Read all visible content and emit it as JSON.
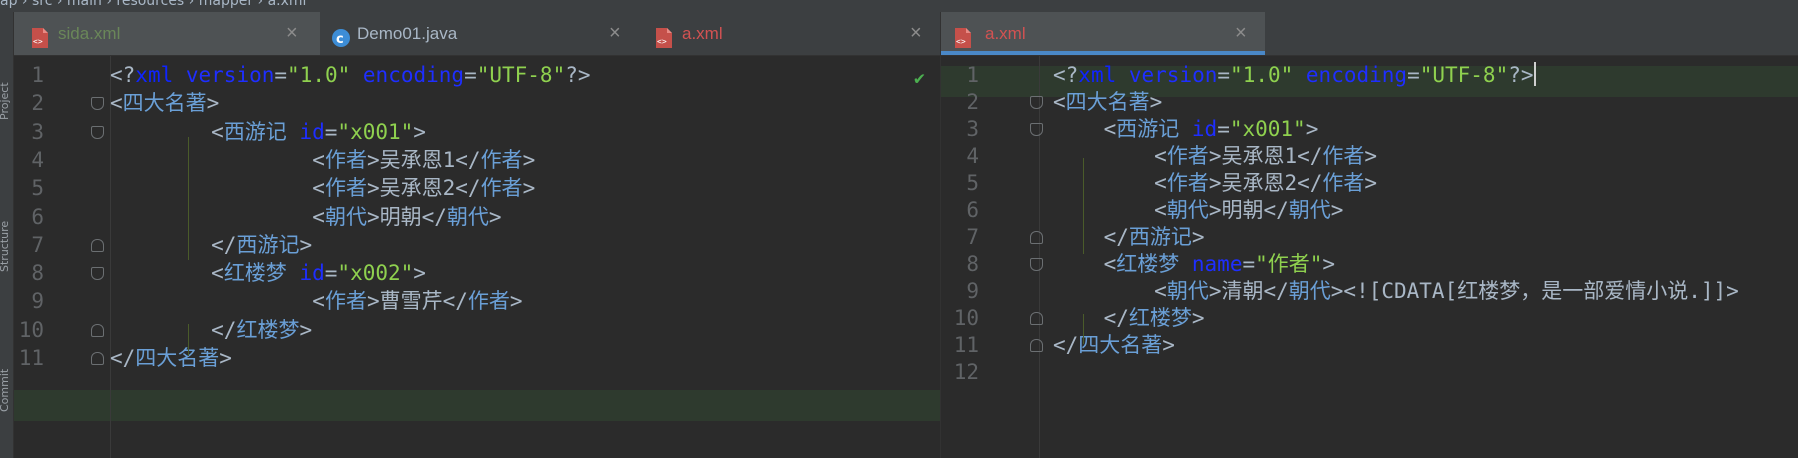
{
  "breadcrumb": "ap ›  src  ›  main  ›  resources  ›  mapper  ›  a.xml",
  "sidebar": {
    "labels": [
      "Project",
      "Structure",
      "Commit"
    ]
  },
  "left_editor": {
    "tabs": [
      {
        "name": "sida.xml",
        "type": "xml",
        "close": "×",
        "color": "#6a8759"
      },
      {
        "name": "Demo01.java",
        "type": "java",
        "close": "×",
        "color": "#a9b7c6"
      },
      {
        "name": "a.xml",
        "type": "xml",
        "close": "×",
        "color": "#d25252"
      }
    ],
    "line_numbers": [
      "1",
      "2",
      "3",
      "4",
      "5",
      "6",
      "7",
      "8",
      "9",
      "10",
      "11"
    ],
    "check_mark": "✔",
    "lines": [
      {
        "indent": "",
        "parts": [
          [
            "tag",
            "<?"
          ],
          [
            "xmldecl",
            "xml "
          ],
          [
            "attr",
            "version"
          ],
          [
            "tag",
            "="
          ],
          [
            "attrv",
            "\"1.0\" "
          ],
          [
            "attr",
            "encoding"
          ],
          [
            "tag",
            "="
          ],
          [
            "attrv",
            "\"UTF-8\""
          ],
          [
            "tag",
            "?>"
          ]
        ]
      },
      {
        "indent": "",
        "parts": [
          [
            "tag",
            "<"
          ],
          [
            "tagname",
            "四大名著"
          ],
          [
            "tag",
            ">"
          ]
        ]
      },
      {
        "indent": "    ",
        "parts": [
          [
            "tag",
            "<"
          ],
          [
            "tagname",
            "西游记 "
          ],
          [
            "attr",
            "id"
          ],
          [
            "tag",
            "="
          ],
          [
            "attrv",
            "\"x001\""
          ],
          [
            "tag",
            ">"
          ]
        ]
      },
      {
        "indent": "        ",
        "parts": [
          [
            "tag",
            "<"
          ],
          [
            "tagname",
            "作者"
          ],
          [
            "tag",
            ">"
          ],
          [
            "txt",
            "吴承恩1"
          ],
          [
            "tag",
            "</"
          ],
          [
            "tagname",
            "作者"
          ],
          [
            "tag",
            ">"
          ]
        ]
      },
      {
        "indent": "        ",
        "parts": [
          [
            "tag",
            "<"
          ],
          [
            "tagname",
            "作者"
          ],
          [
            "tag",
            ">"
          ],
          [
            "txt",
            "吴承恩2"
          ],
          [
            "tag",
            "</"
          ],
          [
            "tagname",
            "作者"
          ],
          [
            "tag",
            ">"
          ]
        ]
      },
      {
        "indent": "        ",
        "parts": [
          [
            "tag",
            "<"
          ],
          [
            "tagname",
            "朝代"
          ],
          [
            "tag",
            ">"
          ],
          [
            "txt",
            "明朝"
          ],
          [
            "tag",
            "</"
          ],
          [
            "tagname",
            "朝代"
          ],
          [
            "tag",
            ">"
          ]
        ]
      },
      {
        "indent": "    ",
        "parts": [
          [
            "tag",
            "</"
          ],
          [
            "tagname",
            "西游记"
          ],
          [
            "tag",
            ">"
          ]
        ]
      },
      {
        "indent": "    ",
        "parts": [
          [
            "tag",
            "<"
          ],
          [
            "tagname",
            "红楼梦 "
          ],
          [
            "attr",
            "id"
          ],
          [
            "tag",
            "="
          ],
          [
            "attrv",
            "\"x002\""
          ],
          [
            "tag",
            ">"
          ]
        ]
      },
      {
        "indent": "        ",
        "parts": [
          [
            "tag",
            "<"
          ],
          [
            "tagname",
            "作者"
          ],
          [
            "tag",
            ">"
          ],
          [
            "txt",
            "曹雪芹"
          ],
          [
            "tag",
            "</"
          ],
          [
            "tagname",
            "作者"
          ],
          [
            "tag",
            ">"
          ]
        ]
      },
      {
        "indent": "    ",
        "parts": [
          [
            "tag",
            "</"
          ],
          [
            "tagname",
            "红楼梦"
          ],
          [
            "tag",
            ">"
          ]
        ]
      },
      {
        "indent": "",
        "parts": [
          [
            "tag",
            "</"
          ],
          [
            "tagname",
            "四大名著"
          ],
          [
            "tag",
            ">"
          ]
        ]
      }
    ]
  },
  "right_editor": {
    "tabs": [
      {
        "name": "a.xml",
        "type": "xml",
        "close": "×",
        "color": "#d25252"
      }
    ],
    "line_numbers": [
      "1",
      "2",
      "3",
      "4",
      "5",
      "6",
      "7",
      "8",
      "9",
      "10",
      "11",
      "12"
    ],
    "lines": [
      {
        "indent": "",
        "parts": [
          [
            "tag",
            "<?"
          ],
          [
            "xmldecl",
            "xml "
          ],
          [
            "attr",
            "version"
          ],
          [
            "tag",
            "="
          ],
          [
            "attrv",
            "\"1.0\" "
          ],
          [
            "attr",
            "encoding"
          ],
          [
            "tag",
            "="
          ],
          [
            "attrv",
            "\"UTF-8\""
          ],
          [
            "tag",
            "?>"
          ]
        ]
      },
      {
        "indent": "",
        "parts": [
          [
            "tag",
            "<"
          ],
          [
            "tagname",
            "四大名著"
          ],
          [
            "tag",
            ">"
          ]
        ]
      },
      {
        "indent": "  ",
        "parts": [
          [
            "tag",
            "<"
          ],
          [
            "tagname",
            "西游记 "
          ],
          [
            "attr",
            "id"
          ],
          [
            "tag",
            "="
          ],
          [
            "attrv",
            "\"x001\""
          ],
          [
            "tag",
            ">"
          ]
        ]
      },
      {
        "indent": "    ",
        "parts": [
          [
            "tag",
            "<"
          ],
          [
            "tagname",
            "作者"
          ],
          [
            "tag",
            ">"
          ],
          [
            "txt",
            "吴承恩1"
          ],
          [
            "tag",
            "</"
          ],
          [
            "tagname",
            "作者"
          ],
          [
            "tag",
            ">"
          ]
        ]
      },
      {
        "indent": "    ",
        "parts": [
          [
            "tag",
            "<"
          ],
          [
            "tagname",
            "作者"
          ],
          [
            "tag",
            ">"
          ],
          [
            "txt",
            "吴承恩2"
          ],
          [
            "tag",
            "</"
          ],
          [
            "tagname",
            "作者"
          ],
          [
            "tag",
            ">"
          ]
        ]
      },
      {
        "indent": "    ",
        "parts": [
          [
            "tag",
            "<"
          ],
          [
            "tagname",
            "朝代"
          ],
          [
            "tag",
            ">"
          ],
          [
            "txt",
            "明朝"
          ],
          [
            "tag",
            "</"
          ],
          [
            "tagname",
            "朝代"
          ],
          [
            "tag",
            ">"
          ]
        ]
      },
      {
        "indent": "  ",
        "parts": [
          [
            "tag",
            "</"
          ],
          [
            "tagname",
            "西游记"
          ],
          [
            "tag",
            ">"
          ]
        ]
      },
      {
        "indent": "  ",
        "parts": [
          [
            "tag",
            "<"
          ],
          [
            "tagname",
            "红楼梦 "
          ],
          [
            "attr",
            "name"
          ],
          [
            "tag",
            "="
          ],
          [
            "attrv",
            "\"作者\""
          ],
          [
            "tag",
            ">"
          ]
        ]
      },
      {
        "indent": "    ",
        "parts": [
          [
            "tag",
            "<"
          ],
          [
            "tagname",
            "朝代"
          ],
          [
            "tag",
            ">"
          ],
          [
            "txt",
            "清朝"
          ],
          [
            "tag",
            "</"
          ],
          [
            "tagname",
            "朝代"
          ],
          [
            "tag",
            ">"
          ],
          [
            "txt",
            "<![CDATA[红楼梦，是一部爱情小说.]]>"
          ]
        ]
      },
      {
        "indent": "  ",
        "parts": [
          [
            "tag",
            "</"
          ],
          [
            "tagname",
            "红楼梦"
          ],
          [
            "tag",
            ">"
          ]
        ]
      },
      {
        "indent": "",
        "parts": [
          [
            "tag",
            "</"
          ],
          [
            "tagname",
            "四大名著"
          ],
          [
            "tag",
            ">"
          ]
        ]
      },
      {
        "indent": "",
        "parts": []
      }
    ]
  }
}
